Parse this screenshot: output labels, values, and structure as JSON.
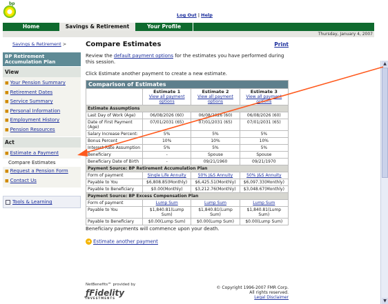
{
  "logo": {
    "text": "bp"
  },
  "top_links": {
    "logout": "Log Out",
    "sep": "|",
    "help": "Help"
  },
  "nav": {
    "tabs": [
      "Home",
      "Savings & Retirement",
      "Your Profile"
    ]
  },
  "date": "Thursday, January 4, 2007",
  "breadcrumb": {
    "label": "Savings & Retirement",
    "sep": ">"
  },
  "leftnav": {
    "header": "BP Retirement Accumulation Plan",
    "view_title": "View",
    "view_items": [
      "Your Pension Summary",
      "Retirement Dates",
      "Service Summary",
      "Personal Information",
      "Employment History",
      "Pension Resources"
    ],
    "act_title": "Act",
    "act_items": [
      "Estimate a Payment",
      "Compare Estimates",
      "Request a Pension Form",
      "Contact Us"
    ],
    "tools": "Tools & Learning"
  },
  "main": {
    "title": "Compare Estimates",
    "print": "Print",
    "intro_pre": "Review the ",
    "intro_link": "default payment options",
    "intro_post": " for the estimates you have performed during this session.",
    "intro2": "Click Estimate another payment to create a new estimate.",
    "note": "Beneficiary payments will commence upon your death.",
    "another": "Estimate another payment"
  },
  "table": {
    "title": "Comparison of Estimates",
    "columns": [
      {
        "name": "Estimate 1",
        "link": "View all payment options"
      },
      {
        "name": "Estimate 2",
        "link": "View all payment options"
      },
      {
        "name": "Estimate 3",
        "link": "View all payment options"
      }
    ],
    "assumptions_title": "Estimate Assumptions",
    "assumptions": [
      {
        "label": "Last Day of Work (Age)",
        "values": [
          "06/08/2026 (60)",
          "06/08/2026 (60)",
          "06/08/2026 (60)"
        ]
      },
      {
        "label": "Date of First Payment (Age)",
        "values": [
          "07/01/2031 (65)",
          "07/01/2031 (65)",
          "07/01/2031 (65)"
        ]
      },
      {
        "label": "Salary Increase Percent:",
        "values": [
          "5%",
          "5%",
          "5%"
        ]
      },
      {
        "label": "Bonus Percent",
        "values": [
          "10%",
          "10%",
          "10%"
        ]
      },
      {
        "label": "Interest Rate Assumption",
        "values": [
          "5%",
          "5%",
          "5%"
        ]
      },
      {
        "label": "Beneficiary",
        "values": [
          "-",
          "Spouse",
          "Spouse"
        ]
      },
      {
        "label": "Beneficiary Date of Birth",
        "values": [
          "-",
          "09/21/1960",
          "09/21/1970"
        ]
      }
    ],
    "source1_title": "Payment Source: BP Retirement Accumulation Plan",
    "source1": [
      {
        "label": "Form of payment",
        "values": [
          "Single Life Annuity",
          "50% J&S Annuity",
          "50% J&S Annuity"
        ],
        "links": true
      },
      {
        "label": "Payable to You",
        "values": [
          "$6,808.85(Monthly)",
          "$6,425.51(Monthly)",
          "$6,097.33(Monthly)"
        ]
      },
      {
        "label": "Payable to Beneficiary",
        "values": [
          "$0.00(Monthly)",
          "$3,212.76(Monthly)",
          "$3,048.67(Monthly)"
        ]
      }
    ],
    "source2_title": "Payment Source: BP Excess Compensation Plan",
    "source2": [
      {
        "label": "Form of payment",
        "values": [
          "Lump Sum",
          "Lump Sum",
          "Lump Sum"
        ],
        "links": true
      },
      {
        "label": "Payable to You",
        "values": [
          "$1,840.81(Lump Sum)",
          "$1,840.81(Lump Sum)",
          "$1,840.81(Lump Sum)"
        ]
      },
      {
        "label": "Payable to Beneficiary",
        "values": [
          "$0.00(Lump Sum)",
          "$0.00(Lump Sum)",
          "$0.00(Lump Sum)"
        ]
      }
    ]
  },
  "footer": {
    "provided": "NetBenefits℠ provided by",
    "fidelity": "Fidelity",
    "investments": "INVESTMENTS",
    "copyright": "© Copyright 1996-2007 FMR Corp.",
    "rights": "All rights reserved.",
    "legal": "Legal Disclaimer"
  },
  "colors": {
    "nav_green": "#0f6a2e",
    "header_teal": "#5e7f8c",
    "link": "#1a2d9c",
    "arrow": "#ff5a1e"
  }
}
